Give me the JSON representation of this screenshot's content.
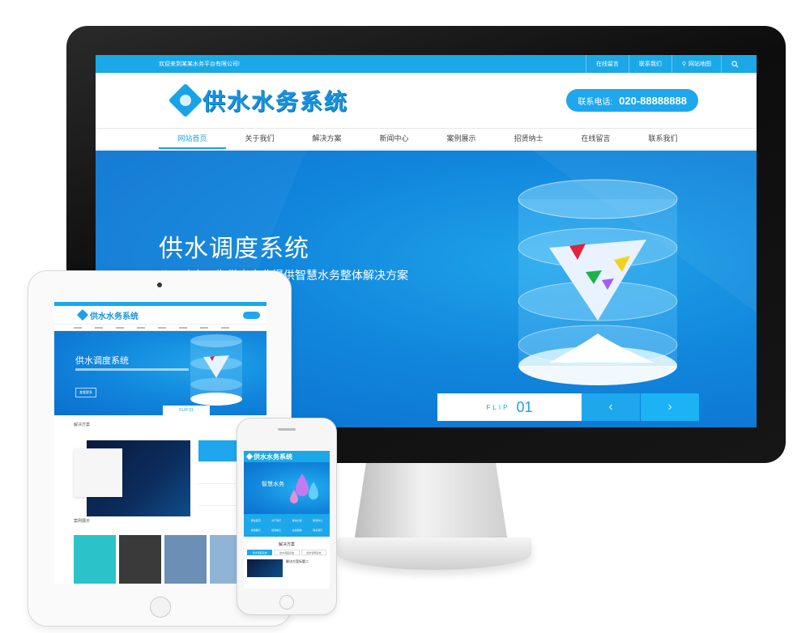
{
  "monitor": {
    "topbar": {
      "welcome": "欢迎来到某某水务平台有限公司!",
      "links": [
        "在线留言",
        "联系我们",
        "网站地图"
      ]
    },
    "logo_text": "供水水务系统",
    "phone": {
      "label": "联系电话:",
      "number": "020-88888888"
    },
    "nav": [
      "网站首页",
      "关于我们",
      "解决方案",
      "新闻中心",
      "案例展示",
      "招贤纳士",
      "在线留言",
      "联系我们"
    ],
    "hero": {
      "title": "供水调度系统",
      "subtitle": "公司致力于为供水企业提供智慧水务整体解决方案",
      "flip_label": "FLIP",
      "flip_number": "01"
    }
  },
  "tablet": {
    "logo_text": "供水水务系统",
    "hero_title": "供水调度系统",
    "hero_button": "查看更多",
    "flip": "FLIP 01",
    "solutions_title": "解决方案",
    "cases_title": "案例展示"
  },
  "phone_device": {
    "logo_text": "供水水务系统",
    "hero_title": "智慧水务",
    "nav": [
      "网站首页",
      "关于我们",
      "解决方案",
      "新闻中心",
      "案例展示",
      "招贤纳士",
      "在线留言",
      "联系我们"
    ],
    "section_title": "解决方案",
    "tabs": [
      "供水调度系统",
      "供水调度系统",
      "供水管网系统"
    ],
    "item_title": "解决方案标题二"
  }
}
